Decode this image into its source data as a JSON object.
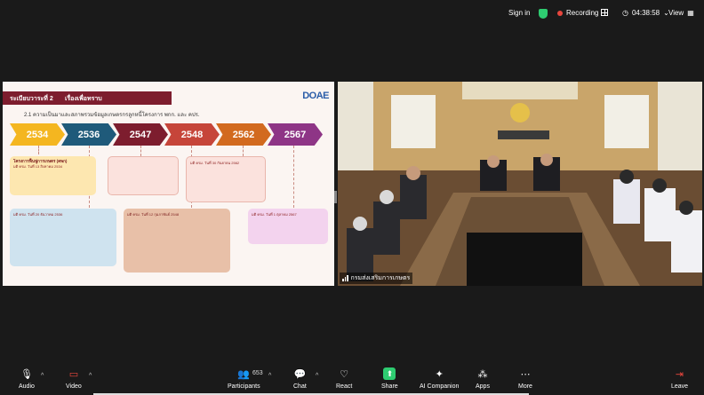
{
  "topbar": {
    "signin": "Sign in",
    "recording": "Recording",
    "time": "04:38:58",
    "view": "View"
  },
  "slide": {
    "header_left": "ระเบียบวาระที่ 2",
    "header_right": "เรื่องเพื่อทราบ",
    "logo": "DOAE",
    "subtitle": "2.1 ความเป็นมาและสภาพรวมข้อมูลเกษตรกรลูกหนี้โครงการ พกก. และ คปร.",
    "years": [
      "2534",
      "2536",
      "2547",
      "2548",
      "2562",
      "2567"
    ],
    "boxes": [
      {
        "title": "โครงการฟื้นฟูการเกษตร (คพก)",
        "date": "มติ ครม. วันที่ 13 สิงหาคม 2534"
      },
      {
        "title": "",
        "date": "มติ ครม. วันที่ 20 ธันวาคม 2536"
      },
      {
        "title": "",
        "date": "มติ ครม. วันที่ 12 กุมภาพันธ์ 2548"
      },
      {
        "title": "",
        "date": "มติ ครม. วันที่ 30 กันยายน 2562"
      },
      {
        "title": "",
        "date": "มติ ครม. วันที่ 1 ตุลาคม 2567"
      }
    ]
  },
  "video": {
    "participant_name": "กรมส่งเสริมการเกษตร"
  },
  "toolbar": {
    "audio": "Audio",
    "video": "Video",
    "participants": "Participants",
    "participants_count": "653",
    "chat": "Chat",
    "react": "React",
    "share": "Share",
    "companion": "AI Companion",
    "apps": "Apps",
    "more": "More",
    "leave": "Leave"
  },
  "colors": {
    "years": [
      "#f4b620",
      "#1f5a7a",
      "#7d1d2e",
      "#c6453a",
      "#d26a1f",
      "#8e3586"
    ]
  }
}
